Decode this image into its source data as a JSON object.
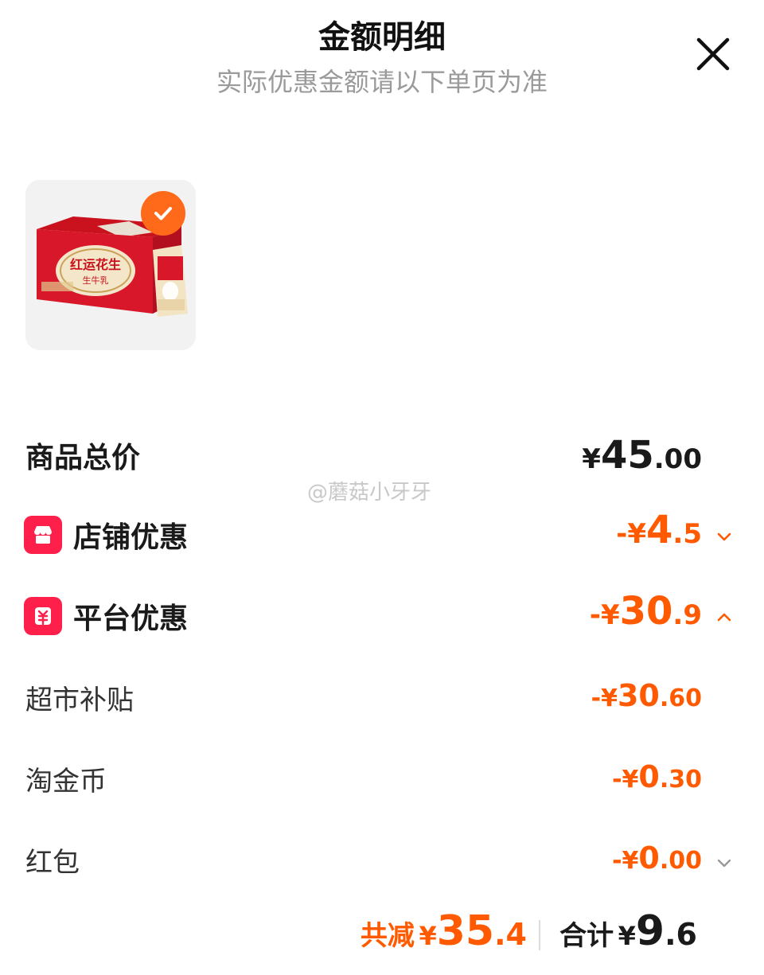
{
  "header": {
    "title": "金额明细",
    "subtitle": "实际优惠金额请以下单页为准"
  },
  "product": {
    "image_text_main": "红运花生",
    "image_text_sub": "生牛乳",
    "selected": true
  },
  "summary": {
    "total_label": "商品总价",
    "total_sym": "¥",
    "total_int": "45",
    "total_dec": ".00",
    "store_label": "店铺优惠",
    "store_sym": "-¥",
    "store_int": "4",
    "store_dec": ".5",
    "platform_label": "平台优惠",
    "platform_sym": "-¥",
    "platform_int": "30",
    "platform_dec": ".9"
  },
  "platform_details": [
    {
      "label": "超市补贴",
      "sym": "-¥",
      "int": "30",
      "dec": ".60"
    },
    {
      "label": "淘金币",
      "sym": "-¥",
      "int": "0",
      "dec": ".30"
    },
    {
      "label": "红包",
      "sym": "-¥",
      "int": "0",
      "dec": ".00"
    }
  ],
  "watermark": "@蘑菇小牙牙",
  "footer": {
    "reduce_label": "共减",
    "reduce_sym": "¥",
    "reduce_int": "35",
    "reduce_dec": ".4",
    "total_label": "合计",
    "total_sym": "¥",
    "total_int": "9",
    "total_dec": ".6"
  },
  "colors": {
    "accent": "#ff5a00",
    "badge": "#ff6a1a",
    "tag": "#ff1f4b"
  }
}
